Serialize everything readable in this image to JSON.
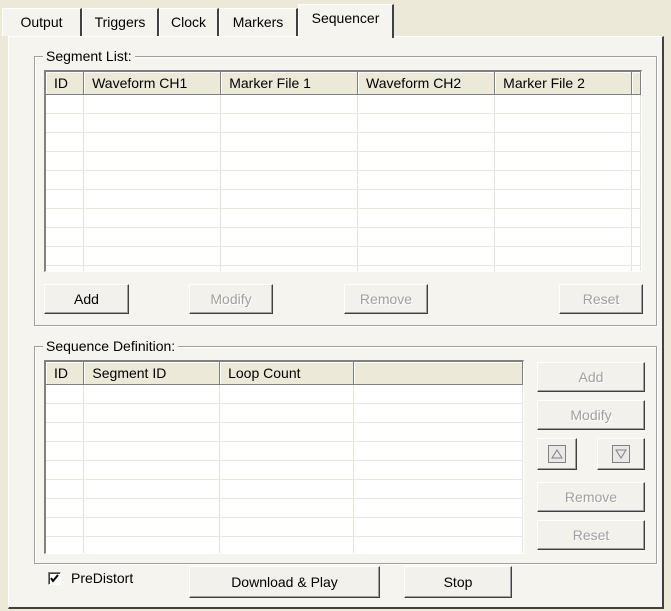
{
  "tabs": [
    {
      "label": "Output",
      "active": false
    },
    {
      "label": "Triggers",
      "active": false
    },
    {
      "label": "Clock",
      "active": false
    },
    {
      "label": "Markers",
      "active": false
    },
    {
      "label": "Sequencer",
      "active": true
    }
  ],
  "segment_list": {
    "title": "Segment List:",
    "columns": [
      "ID",
      "Waveform CH1",
      "Marker File 1",
      "Waveform CH2",
      "Marker File 2"
    ],
    "rows": [],
    "buttons": {
      "add": "Add",
      "modify": "Modify",
      "remove": "Remove",
      "reset": "Reset"
    }
  },
  "sequence_definition": {
    "title": "Sequence Definition:",
    "columns": [
      "ID",
      "Segment ID",
      "Loop Count",
      ""
    ],
    "rows": [],
    "buttons": {
      "add": "Add",
      "modify": "Modify",
      "remove": "Remove",
      "reset": "Reset"
    }
  },
  "predistort": {
    "label": "PreDistort",
    "checked": true
  },
  "actions": {
    "download_play": "Download & Play",
    "stop": "Stop"
  },
  "colors": {
    "face": "#ECE9D8",
    "panel": "#F5F4EF",
    "disabled_text": "#A0A0A0"
  }
}
